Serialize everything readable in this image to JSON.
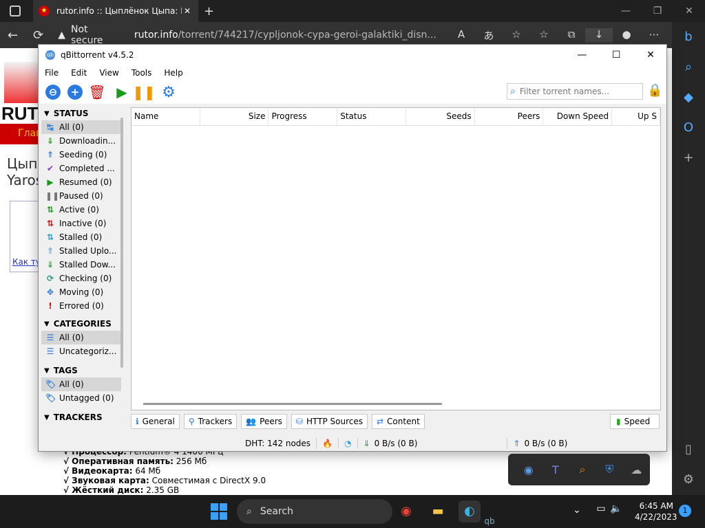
{
  "browser": {
    "tab_title": "rutor.info :: Цыплёнок Цыпа: Гер",
    "new_tab": "+",
    "warning_text": "Not secure",
    "url_host": "rutor.info",
    "url_path": "/torrent/744217/cypljonok-cypa-geroi-galaktiki_disn..."
  },
  "webpage": {
    "logo_text": "RUT",
    "nav_text": "Глав",
    "line1": "Цыпл",
    "line2": "Yaros",
    "link_text": "Как ту",
    "specs": [
      {
        "label": "√ Процессор:",
        "value": " Pentium® 4 1400 МГц"
      },
      {
        "label": "√ Оперативная память:",
        "value": " 256 Мб"
      },
      {
        "label": "√ Видеокарта:",
        "value": " 64 Мб"
      },
      {
        "label": "√ Звуковая карта:",
        "value": " Совместимая с DirectX 9.0"
      },
      {
        "label": "√ Жёсткий диск:",
        "value": " 2.35 GB"
      }
    ]
  },
  "qb": {
    "title": "qBittorrent v4.5.2",
    "menu": [
      "File",
      "Edit",
      "View",
      "Tools",
      "Help"
    ],
    "filter_placeholder": "Filter torrent names...",
    "sections": {
      "status": "STATUS",
      "categories": "CATEGORIES",
      "tags": "TAGS",
      "trackers": "TRACKERS"
    },
    "status_filters": [
      {
        "label": "All (0)",
        "icon": "↹",
        "color": "#2a7ae0",
        "selected": true
      },
      {
        "label": "Downloadin...",
        "icon": "⇓",
        "color": "#1a9a1a",
        "selected": false
      },
      {
        "label": "Seeding (0)",
        "icon": "⇑",
        "color": "#2a7ae0",
        "selected": false
      },
      {
        "label": "Completed ...",
        "icon": "✔",
        "color": "#7a3ac8",
        "selected": false
      },
      {
        "label": "Resumed (0)",
        "icon": "▶",
        "color": "#1a9a1a",
        "selected": false
      },
      {
        "label": "Paused (0)",
        "icon": "❚❚",
        "color": "#777",
        "selected": false
      },
      {
        "label": "Active (0)",
        "icon": "⇅",
        "color": "#1a9a1a",
        "selected": false
      },
      {
        "label": "Inactive (0)",
        "icon": "⇅",
        "color": "#d01010",
        "selected": false
      },
      {
        "label": "Stalled (0)",
        "icon": "⇅",
        "color": "#2a9ad8",
        "selected": false
      },
      {
        "label": "Stalled Uplo...",
        "icon": "⇑",
        "color": "#6aa0e0",
        "selected": false
      },
      {
        "label": "Stalled Dow...",
        "icon": "⇓",
        "color": "#2a9a3a",
        "selected": false
      },
      {
        "label": "Checking (0)",
        "icon": "⟳",
        "color": "#1a9a7a",
        "selected": false
      },
      {
        "label": "Moving (0)",
        "icon": "✥",
        "color": "#2a7ae0",
        "selected": false
      },
      {
        "label": "Errored (0)",
        "icon": "!",
        "color": "#d01010",
        "selected": false
      }
    ],
    "category_filters": [
      {
        "label": "All (0)",
        "selected": true
      },
      {
        "label": "Uncategoriz...",
        "selected": false
      }
    ],
    "tag_filters": [
      {
        "label": "All (0)",
        "selected": true
      },
      {
        "label": "Untagged (0)",
        "selected": false
      }
    ],
    "columns": [
      {
        "label": "Name",
        "align": "left"
      },
      {
        "label": "Size",
        "align": "right"
      },
      {
        "label": "Progress",
        "align": "left"
      },
      {
        "label": "Status",
        "align": "left"
      },
      {
        "label": "Seeds",
        "align": "right"
      },
      {
        "label": "Peers",
        "align": "right"
      },
      {
        "label": "Down Speed",
        "align": "right"
      },
      {
        "label": "Up S",
        "align": "right"
      }
    ],
    "bottom_tabs": [
      "General",
      "Trackers",
      "Peers",
      "HTTP Sources",
      "Content"
    ],
    "speed_tab": "Speed",
    "status_bar": {
      "dht": "DHT: 142 nodes",
      "down": "0 B/s (0 B)",
      "up": "0 B/s (0 B)"
    }
  },
  "taskbar": {
    "search_label": "Search",
    "time": "6:45 AM",
    "date": "4/22/2023",
    "notif_count": "1"
  }
}
